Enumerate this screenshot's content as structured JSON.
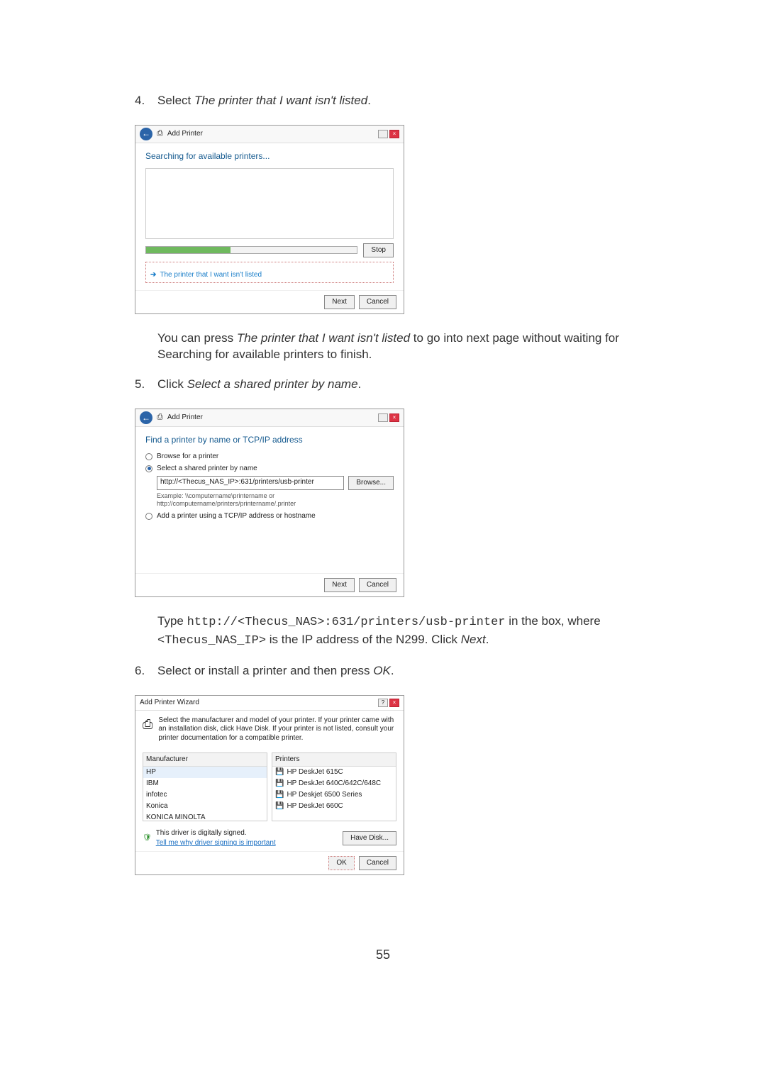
{
  "steps": {
    "s4": {
      "num": "4.",
      "pre": "Select",
      "ital": "The printer that I want isn't listed",
      "post": "."
    },
    "s5": {
      "num": "5.",
      "pre": "Click",
      "ital": "Select a shared printer by name",
      "post": "."
    },
    "s6": {
      "num": "6.",
      "pre": "Select or install a printer and then press",
      "ital": "OK",
      "post": "."
    }
  },
  "post_s4a": "You can press",
  "post_s4b": "The printer that I want isn't listed",
  "post_s4c": "to go into next page without waiting for Searching for available printers to finish.",
  "post_s5a": "Type",
  "post_s5_url": "http://<Thecus_NAS>:631/printers/usb-printer",
  "post_s5b": "in the box, where",
  "post_s5_ip": "<Thecus_NAS_IP>",
  "post_s5c": "is the IP address of the N299. Click",
  "post_s5d": "Next",
  "post_s5e": ".",
  "dlg1": {
    "title": "Add Printer",
    "section": "Searching for available printers...",
    "stop": "Stop",
    "link": "The printer that I want isn't listed",
    "next": "Next",
    "cancel": "Cancel"
  },
  "dlg2": {
    "title": "Add Printer",
    "section": "Find a printer by name or TCP/IP address",
    "opt1": "Browse for a printer",
    "opt2": "Select a shared printer by name",
    "input": "http://<Thecus_NAS_IP>:631/printers/usb-printer",
    "browse": "Browse...",
    "example": "Example: \\\\computername\\printername or http://computername/printers/printername/.printer",
    "opt3": "Add a printer using a TCP/IP address or hostname",
    "next": "Next",
    "cancel": "Cancel"
  },
  "dlg3": {
    "title": "Add Printer Wizard",
    "instr": "Select the manufacturer and model of your printer. If your printer came with an installation disk, click Have Disk. If your printer is not listed, consult your printer documentation for a compatible printer.",
    "col1": "Manufacturer",
    "col2": "Printers",
    "manufacturers": [
      "HP",
      "IBM",
      "infotec",
      "Konica",
      "KONICA MINOLTA"
    ],
    "printers": [
      "HP DeskJet 615C",
      "HP DeskJet 640C/642C/648C",
      "HP Deskjet 6500 Series",
      "HP DeskJet 660C"
    ],
    "signed": "This driver is digitally signed.",
    "tellme": "Tell me why driver signing is important",
    "havedisk": "Have Disk...",
    "ok": "OK",
    "cancel": "Cancel"
  },
  "page": "55"
}
